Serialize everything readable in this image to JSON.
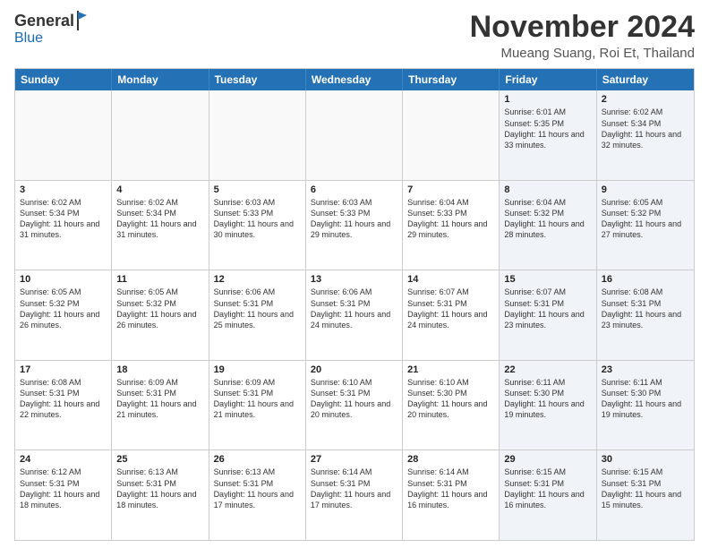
{
  "logo": {
    "general": "General",
    "blue": "Blue"
  },
  "header": {
    "month": "November 2024",
    "location": "Mueang Suang, Roi Et, Thailand"
  },
  "days": [
    "Sunday",
    "Monday",
    "Tuesday",
    "Wednesday",
    "Thursday",
    "Friday",
    "Saturday"
  ],
  "rows": [
    [
      {
        "day": "",
        "empty": true
      },
      {
        "day": "",
        "empty": true
      },
      {
        "day": "",
        "empty": true
      },
      {
        "day": "",
        "empty": true
      },
      {
        "day": "",
        "empty": true
      },
      {
        "day": "1",
        "info": "Sunrise: 6:01 AM\nSunset: 5:35 PM\nDaylight: 11 hours and 33 minutes."
      },
      {
        "day": "2",
        "info": "Sunrise: 6:02 AM\nSunset: 5:34 PM\nDaylight: 11 hours and 32 minutes."
      }
    ],
    [
      {
        "day": "3",
        "info": "Sunrise: 6:02 AM\nSunset: 5:34 PM\nDaylight: 11 hours and 31 minutes."
      },
      {
        "day": "4",
        "info": "Sunrise: 6:02 AM\nSunset: 5:34 PM\nDaylight: 11 hours and 31 minutes."
      },
      {
        "day": "5",
        "info": "Sunrise: 6:03 AM\nSunset: 5:33 PM\nDaylight: 11 hours and 30 minutes."
      },
      {
        "day": "6",
        "info": "Sunrise: 6:03 AM\nSunset: 5:33 PM\nDaylight: 11 hours and 29 minutes."
      },
      {
        "day": "7",
        "info": "Sunrise: 6:04 AM\nSunset: 5:33 PM\nDaylight: 11 hours and 29 minutes."
      },
      {
        "day": "8",
        "info": "Sunrise: 6:04 AM\nSunset: 5:32 PM\nDaylight: 11 hours and 28 minutes."
      },
      {
        "day": "9",
        "info": "Sunrise: 6:05 AM\nSunset: 5:32 PM\nDaylight: 11 hours and 27 minutes."
      }
    ],
    [
      {
        "day": "10",
        "info": "Sunrise: 6:05 AM\nSunset: 5:32 PM\nDaylight: 11 hours and 26 minutes."
      },
      {
        "day": "11",
        "info": "Sunrise: 6:05 AM\nSunset: 5:32 PM\nDaylight: 11 hours and 26 minutes."
      },
      {
        "day": "12",
        "info": "Sunrise: 6:06 AM\nSunset: 5:31 PM\nDaylight: 11 hours and 25 minutes."
      },
      {
        "day": "13",
        "info": "Sunrise: 6:06 AM\nSunset: 5:31 PM\nDaylight: 11 hours and 24 minutes."
      },
      {
        "day": "14",
        "info": "Sunrise: 6:07 AM\nSunset: 5:31 PM\nDaylight: 11 hours and 24 minutes."
      },
      {
        "day": "15",
        "info": "Sunrise: 6:07 AM\nSunset: 5:31 PM\nDaylight: 11 hours and 23 minutes."
      },
      {
        "day": "16",
        "info": "Sunrise: 6:08 AM\nSunset: 5:31 PM\nDaylight: 11 hours and 23 minutes."
      }
    ],
    [
      {
        "day": "17",
        "info": "Sunrise: 6:08 AM\nSunset: 5:31 PM\nDaylight: 11 hours and 22 minutes."
      },
      {
        "day": "18",
        "info": "Sunrise: 6:09 AM\nSunset: 5:31 PM\nDaylight: 11 hours and 21 minutes."
      },
      {
        "day": "19",
        "info": "Sunrise: 6:09 AM\nSunset: 5:31 PM\nDaylight: 11 hours and 21 minutes."
      },
      {
        "day": "20",
        "info": "Sunrise: 6:10 AM\nSunset: 5:31 PM\nDaylight: 11 hours and 20 minutes."
      },
      {
        "day": "21",
        "info": "Sunrise: 6:10 AM\nSunset: 5:30 PM\nDaylight: 11 hours and 20 minutes."
      },
      {
        "day": "22",
        "info": "Sunrise: 6:11 AM\nSunset: 5:30 PM\nDaylight: 11 hours and 19 minutes."
      },
      {
        "day": "23",
        "info": "Sunrise: 6:11 AM\nSunset: 5:30 PM\nDaylight: 11 hours and 19 minutes."
      }
    ],
    [
      {
        "day": "24",
        "info": "Sunrise: 6:12 AM\nSunset: 5:31 PM\nDaylight: 11 hours and 18 minutes."
      },
      {
        "day": "25",
        "info": "Sunrise: 6:13 AM\nSunset: 5:31 PM\nDaylight: 11 hours and 18 minutes."
      },
      {
        "day": "26",
        "info": "Sunrise: 6:13 AM\nSunset: 5:31 PM\nDaylight: 11 hours and 17 minutes."
      },
      {
        "day": "27",
        "info": "Sunrise: 6:14 AM\nSunset: 5:31 PM\nDaylight: 11 hours and 17 minutes."
      },
      {
        "day": "28",
        "info": "Sunrise: 6:14 AM\nSunset: 5:31 PM\nDaylight: 11 hours and 16 minutes."
      },
      {
        "day": "29",
        "info": "Sunrise: 6:15 AM\nSunset: 5:31 PM\nDaylight: 11 hours and 16 minutes."
      },
      {
        "day": "30",
        "info": "Sunrise: 6:15 AM\nSunset: 5:31 PM\nDaylight: 11 hours and 15 minutes."
      }
    ]
  ]
}
